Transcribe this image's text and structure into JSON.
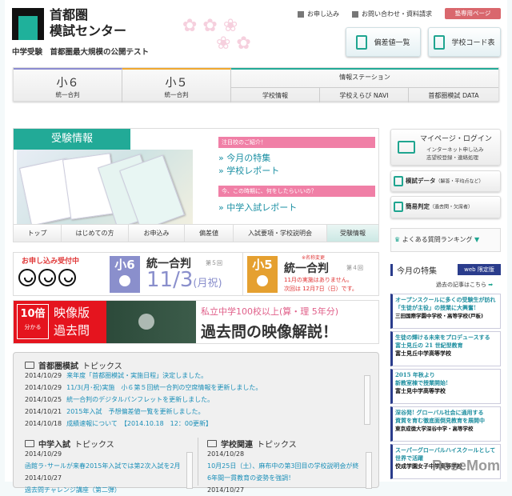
{
  "header": {
    "logo_line1": "首都圏",
    "logo_line2": "模試センター",
    "tagline": "中学受験　首都圏最大規模の公開テスト",
    "links": [
      "お申し込み",
      "お問い合わせ・資料請求"
    ],
    "member_label": "塾専用ページ",
    "quick_buttons": [
      "偏差値一覧",
      "学校コード表"
    ]
  },
  "nav": {
    "g6": {
      "title": "小６",
      "sub": "統一合判"
    },
    "g5": {
      "title": "小５",
      "sub": "統一合判"
    },
    "station": "情報ステーション",
    "station_items": [
      "学校情報",
      "学校えらび NAVI",
      "首都圏模試 DATA"
    ],
    "colors": {
      "g6": "#8c8cd0",
      "g5": "#f0a830",
      "station": "#22aa97"
    }
  },
  "panel": {
    "title": "受験情報",
    "bar1": "注目校のご紹介！",
    "links1": [
      "今月の特集",
      "学校レポート"
    ],
    "bar2": "今、この時期に、何をしたらいいの？",
    "links2": [
      "中学入試レポート"
    ],
    "tabs": [
      "トップ",
      "はじめての方",
      "お申込み",
      "偏差値",
      "入試要項・学校説明会",
      "受験情報"
    ],
    "active_tab": "受験情報"
  },
  "banner1": {
    "open": "お申し込み受付中",
    "g6": "小6",
    "g6_title": "統一合判",
    "g6_round": "第５回",
    "g6_date": "11/3",
    "g6_day": "(月祝)",
    "g5": "小5",
    "g5_note": "※名称変更",
    "g5_title": "統一合判",
    "g5_round": "第４回",
    "g5_msg1": "11月の実施はありません。",
    "g5_msg2": "次回は 12月7日（日）です。"
  },
  "banner2": {
    "times": "10倍",
    "understand": "分かる",
    "title1": "映像版",
    "title2": "過去問",
    "line1": "私立中学100校以上(算・理 5年分)",
    "line2": "過去問の映像解説！"
  },
  "topics": {
    "main": {
      "bold": "首都圏模試",
      "rest": "トピックス",
      "items": [
        {
          "date": "2014/10/29",
          "text": "来年度「首都圏模試・実施日程」決定しました。"
        },
        {
          "date": "2014/10/29",
          "text": "11/3(月･祝)実施　小６第５回統一合判の空席情報を更新しました。"
        },
        {
          "date": "2014/10/25",
          "text": "統一合判のデジタルパンフレットを更新しました。"
        },
        {
          "date": "2014/10/21",
          "text": "2015年入試　予想偏差値一覧を更新しました。"
        },
        {
          "date": "2014/10/18",
          "text": "成績速報について　【2014.10.18　12：00更新】"
        }
      ]
    },
    "exam": {
      "bold": "中学入試",
      "rest": "トピックス",
      "items": [
        {
          "date": "2014/10/29",
          "text": "函館ラ･サールが来春2015年入試では第2次入試を2月"
        },
        {
          "date": "2014/10/27",
          "text": "過去問チャレンジ講座（第二弾）"
        }
      ]
    },
    "school": {
      "bold": "学校関連",
      "rest": "トピックス",
      "items": [
        {
          "date": "2014/10/28",
          "text": "10月25日（土）、麻布中の第3回目の学校説明会が終",
          "text2": "6年間一貫教育の姿勢を強調！"
        },
        {
          "date": "2014/10/27",
          "text": ""
        }
      ]
    }
  },
  "sidebar": {
    "mypage": "マイページ・ログイン",
    "mypage_sub1": "インターネット申し込み",
    "mypage_sub2": "志望校登録・連絡処理",
    "data_bold": "模試データ",
    "data_rest": "（解答・平均点など）",
    "judge_bold": "簡易判定",
    "judge_rest": "（過去問・欠席者）",
    "ranking": "よくある質問ランキング",
    "feature": "今月の特集",
    "web_badge": "web 限定版",
    "past": "過去の記事はこちら",
    "ads": [
      {
        "h1": "オープンスクールに多くの受験生が訪れ",
        "h2": "「生徒が主役」の授業に大興奮!",
        "school": "三田国際学園中学校・高等学校(戸板)"
      },
      {
        "h1": "生徒の輝ける未来をプロデュースする",
        "h2": "富士見丘の 21 世紀型教育",
        "school": "富士見丘中学高等学校"
      },
      {
        "h1": "2015 年秋より",
        "h2": "新教室棟で授業開始!",
        "school": "富士見中学高等学校"
      },
      {
        "h1": "深谷発! グローバル社会に通用する",
        "h2": "資質を育む徹底面倒見教育を展開中",
        "school": "東京成徳大学深谷中学・高等学校"
      },
      {
        "h1": "スーパーグローバルハイスクールとして",
        "h2": "世界で活躍",
        "school": "佼成学園女子中学高等学校"
      }
    ]
  },
  "watermark": "ReseMom"
}
